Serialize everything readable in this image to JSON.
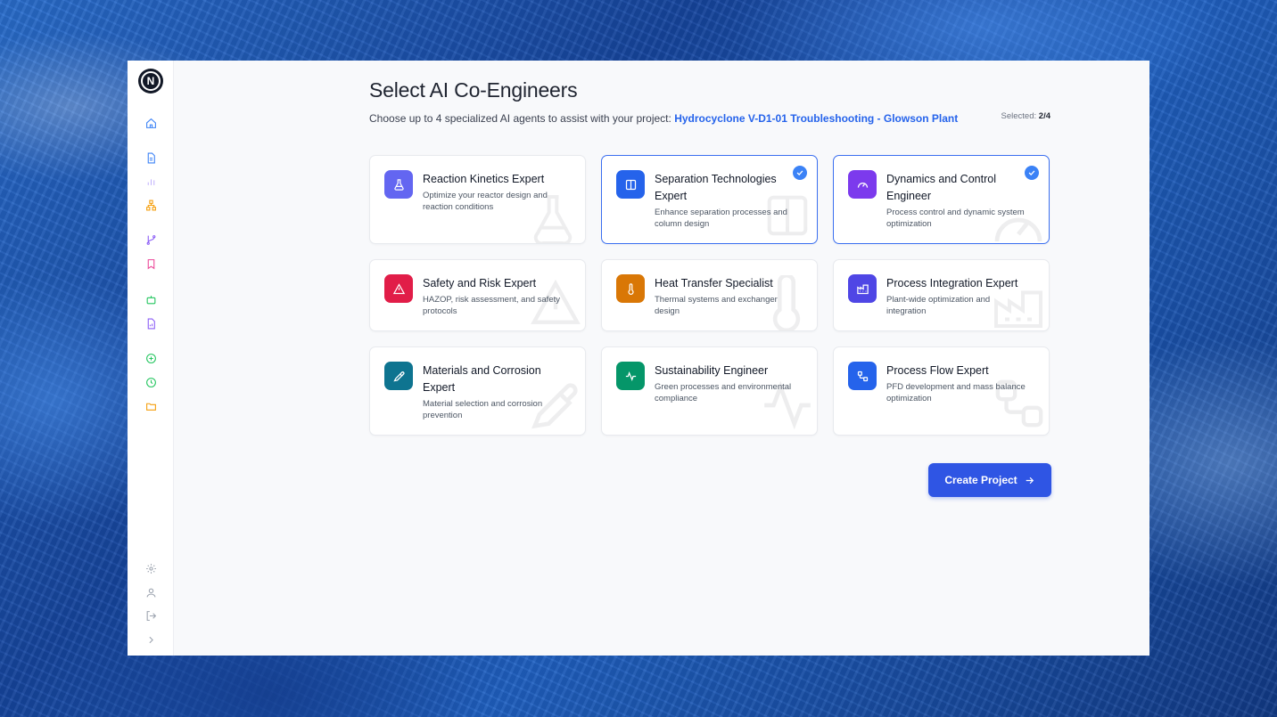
{
  "header": {
    "title": "Select AI Co-Engineers",
    "subtitle_prefix": "Choose up to 4 specialized AI agents to assist with your project: ",
    "project_name": "Hydrocyclone V-D1-01 Troubleshooting - Glowson Plant",
    "selected_label": "Selected:",
    "selected_value": "2/4"
  },
  "logo": {
    "letter": "N"
  },
  "sidebar": {
    "top_icons": [
      {
        "name": "home-icon",
        "color": "#3b82f6"
      },
      {
        "name": "document-icon",
        "color": "#3b82f6"
      },
      {
        "name": "bar-chart-icon",
        "color": "#c4b5fd"
      },
      {
        "name": "hierarchy-icon",
        "color": "#f59e0b"
      },
      {
        "name": "git-branch-icon",
        "color": "#8b5cf6"
      },
      {
        "name": "bookmark-icon",
        "color": "#ec4899"
      },
      {
        "name": "robot-icon",
        "color": "#22c55e"
      },
      {
        "name": "file-chart-icon",
        "color": "#8b5cf6"
      },
      {
        "name": "plus-circle-icon",
        "color": "#22c55e"
      },
      {
        "name": "clock-icon",
        "color": "#22c55e"
      },
      {
        "name": "folder-icon",
        "color": "#f59e0b"
      }
    ],
    "bottom_icons": [
      {
        "name": "settings-icon",
        "color": "#9ca3af"
      },
      {
        "name": "user-icon",
        "color": "#9ca3af"
      },
      {
        "name": "logout-icon",
        "color": "#9ca3af"
      },
      {
        "name": "chevron-right-icon",
        "color": "#9ca3af"
      }
    ]
  },
  "agents": [
    {
      "title": "Reaction Kinetics Expert",
      "description": "Optimize your reactor design and reaction conditions",
      "icon": "flask-icon",
      "color": "#6366f1",
      "selected": false
    },
    {
      "title": "Separation Technologies Expert",
      "description": "Enhance separation processes and column design",
      "icon": "columns-icon",
      "color": "#2563eb",
      "selected": true
    },
    {
      "title": "Dynamics and Control Engineer",
      "description": "Process control and dynamic system optimization",
      "icon": "gauge-icon",
      "color": "#7c3aed",
      "selected": true
    },
    {
      "title": "Safety and Risk Expert",
      "description": "HAZOP, risk assessment, and safety protocols",
      "icon": "warning-icon",
      "color": "#e11d48",
      "selected": false
    },
    {
      "title": "Heat Transfer Specialist",
      "description": "Thermal systems and exchanger design",
      "icon": "thermometer-icon",
      "color": "#d97706",
      "selected": false
    },
    {
      "title": "Process Integration Expert",
      "description": "Plant-wide optimization and integration",
      "icon": "factory-icon",
      "color": "#4f46e5",
      "selected": false
    },
    {
      "title": "Materials and Corrosion Expert",
      "description": "Material selection and corrosion prevention",
      "icon": "pipette-icon",
      "color": "#0e7490",
      "selected": false
    },
    {
      "title": "Sustainability Engineer",
      "description": "Green processes and environmental compliance",
      "icon": "activity-icon",
      "color": "#059669",
      "selected": false
    },
    {
      "title": "Process Flow Expert",
      "description": "PFD development and mass balance optimization",
      "icon": "workflow-icon",
      "color": "#2563eb",
      "selected": false
    }
  ],
  "actions": {
    "create_label": "Create Project",
    "create_icon": "arrow-right-icon"
  }
}
